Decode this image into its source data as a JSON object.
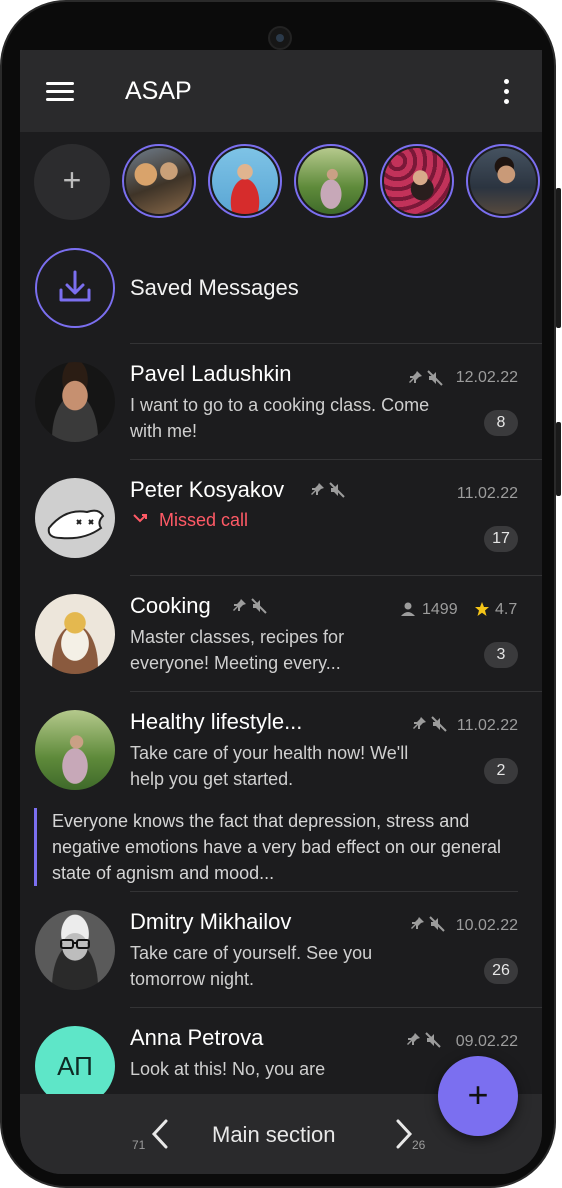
{
  "app_bar": {
    "title": "ASAP",
    "menu_icon": "hamburger-menu-icon",
    "more_icon": "vertical-dots-icon"
  },
  "stories": {
    "add_label": "+",
    "count": 5
  },
  "saved": {
    "label": "Saved Messages",
    "icon": "download-icon"
  },
  "chats": [
    {
      "name": "Pavel Ladushkin",
      "date": "12.02.22",
      "preview": "I want to go to a cooking class. Come with me!",
      "badge": "8",
      "pinned": true,
      "muted": true
    },
    {
      "name": "Peter Kosyakov",
      "date": "11.02.22",
      "status": "Missed call",
      "badge": "17",
      "pinned": true,
      "muted": true
    },
    {
      "name": "Cooking",
      "members": "1499",
      "rating": "4.7",
      "preview": "Master classes, recipes for everyone! Meeting every...",
      "badge": "3",
      "pinned": true,
      "muted": true
    },
    {
      "name": "Healthy lifestyle...",
      "date": "11.02.22",
      "preview": "Take care of your health now! We'll help you get started.",
      "badge": "2",
      "pinned": true,
      "muted": true,
      "quote": "Everyone knows the fact that depression, stress and negative emotions have a very bad effect on our general state of agnism and mood..."
    },
    {
      "name": "Dmitry Mikhailov",
      "date": "10.02.22",
      "preview": "Take care of yourself. See you tomorrow night.",
      "badge": "26",
      "pinned": true,
      "muted": true
    },
    {
      "name": "Anna Petrova",
      "date": "09.02.22",
      "preview": "Look at this! No, you are",
      "initials": "АП",
      "pinned": true,
      "muted": true
    }
  ],
  "bottom_bar": {
    "label": "Main section",
    "prev_count": "71",
    "next_count": "26"
  },
  "fab": {
    "label": "+"
  },
  "colors": {
    "accent": "#7b6ff0",
    "background": "#1c1c1e",
    "bar": "#2a2a2c",
    "missed": "#ff5a66",
    "star": "#f5c518",
    "anna_avatar": "#5ee6c8"
  }
}
